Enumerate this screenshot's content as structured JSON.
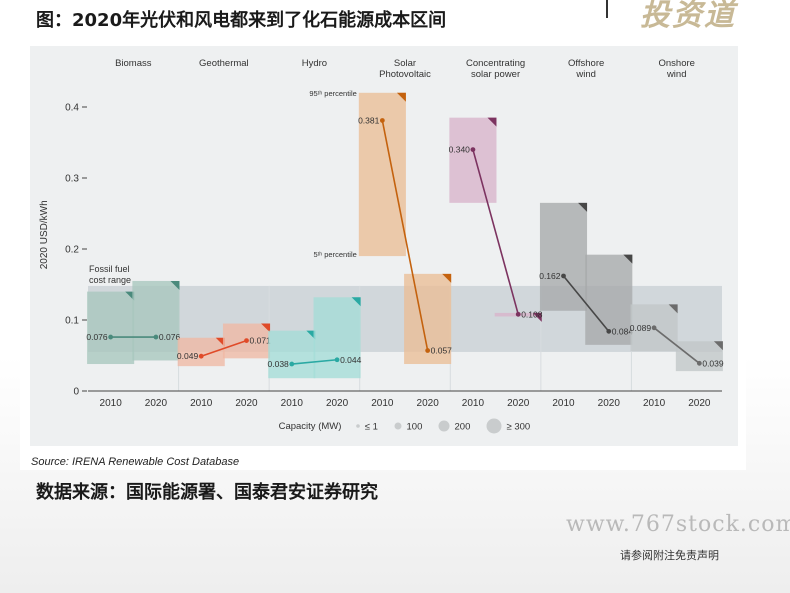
{
  "header": {
    "title": "图：2020年光伏和风电都来到了化石能源成本区间"
  },
  "logo": {
    "text": "投资道"
  },
  "source": "Source: IRENA Renewable Cost Database",
  "data_source": "数据来源：国际能源署、国泰君安证券研究",
  "watermark": "www.767stock.com",
  "disclaimer": "请参阅附注免责声明",
  "chart_data": {
    "type": "scatter",
    "ylabel": "2020 USD/kWh",
    "ylim": [
      0,
      0.45
    ],
    "yticks": [
      0,
      0.1,
      0.2,
      0.3,
      0.4
    ],
    "ytick_labels": [
      "0",
      "0.1",
      "0.2",
      "0.3",
      "0.4"
    ],
    "xlabel": "",
    "fossil_band": {
      "label_lines": [
        "Fossil fuel",
        "cost range"
      ],
      "range": [
        0.055,
        0.148
      ],
      "color": "#b9c3c8"
    },
    "annotations": {
      "p95": "95ᵗʰ percentile",
      "p5": "5ᵗʰ percentile"
    },
    "series": [
      {
        "name": "Biomass",
        "label_lines": [
          "Biomass"
        ],
        "color": "#4a8a7c",
        "box_color": "#a8c6be",
        "years": [
          "2010",
          "2020"
        ],
        "p5": [
          0.038,
          0.043
        ],
        "p95": [
          0.14,
          0.155
        ],
        "values": [
          0.076,
          0.076
        ],
        "labels": [
          "0.076",
          "0.076"
        ]
      },
      {
        "name": "Geothermal",
        "label_lines": [
          "Geothermal"
        ],
        "color": "#e04a28",
        "box_color": "#f0b9a4",
        "years": [
          "2010",
          "2020"
        ],
        "p5": [
          0.035,
          0.046
        ],
        "p95": [
          0.075,
          0.095
        ],
        "values": [
          0.049,
          0.071
        ],
        "labels": [
          "0.049",
          "0.071"
        ]
      },
      {
        "name": "Hydro",
        "label_lines": [
          "Hydro"
        ],
        "color": "#2aa9a3",
        "box_color": "#a4dcd7",
        "years": [
          "2010",
          "2020"
        ],
        "p5": [
          0.018,
          0.018
        ],
        "p95": [
          0.085,
          0.132
        ],
        "values": [
          0.038,
          0.044
        ],
        "labels": [
          "0.038",
          "0.044"
        ]
      },
      {
        "name": "Solar Photovoltaic",
        "label_lines": [
          "Solar",
          "Photovoltaic"
        ],
        "color": "#c4620e",
        "box_color": "#ebbe96",
        "years": [
          "2010",
          "2020"
        ],
        "p5": [
          0.19,
          0.038
        ],
        "p95": [
          0.42,
          0.165
        ],
        "values": [
          0.381,
          0.057
        ],
        "labels": [
          "0.381",
          "0.057"
        ]
      },
      {
        "name": "Concentrating solar power",
        "label_lines": [
          "Concentrating",
          "solar power"
        ],
        "color": "#7c3360",
        "box_color": "#d8b4cb",
        "years": [
          "2010",
          "2020"
        ],
        "p5": [
          0.265,
          0.105
        ],
        "p95": [
          0.385,
          0.11
        ],
        "values": [
          0.34,
          0.108
        ],
        "labels": [
          "0.340",
          "0.108"
        ]
      },
      {
        "name": "Offshore wind",
        "label_lines": [
          "Offshore",
          "wind"
        ],
        "color": "#474747",
        "box_color": "#a7a9aa",
        "years": [
          "2010",
          "2020"
        ],
        "p5": [
          0.113,
          0.065
        ],
        "p95": [
          0.265,
          0.192
        ],
        "values": [
          0.162,
          0.084
        ],
        "labels": [
          "0.162",
          "0.084"
        ]
      },
      {
        "name": "Onshore wind",
        "label_lines": [
          "Onshore",
          "wind"
        ],
        "color": "#6c6c6c",
        "box_color": "#c2c6c8",
        "years": [
          "2010",
          "2020"
        ],
        "p5": [
          0.056,
          0.028
        ],
        "p95": [
          0.122,
          0.07
        ],
        "values": [
          0.089,
          0.039
        ],
        "labels": [
          "0.089",
          "0.039"
        ]
      }
    ],
    "capacity_legend": {
      "title": "Capacity (MW)",
      "items": [
        {
          "label": "≤ 1"
        },
        {
          "label": "100"
        },
        {
          "label": "200"
        },
        {
          "label": "≥ 300"
        }
      ]
    }
  }
}
